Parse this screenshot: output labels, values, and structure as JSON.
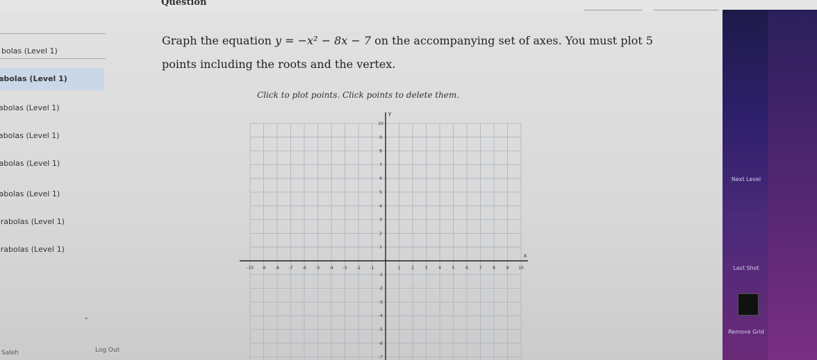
{
  "header": {
    "title": "Question"
  },
  "sidebar": {
    "items": [
      {
        "label": "bolas (Level 1)",
        "active": false
      },
      {
        "label": "abolas (Level 1)",
        "active": true
      },
      {
        "label": "abolas (Level 1)",
        "active": false
      },
      {
        "label": "abolas (Level 1)",
        "active": false
      },
      {
        "label": "rabolas (Level 1)",
        "active": false
      },
      {
        "label": "rabolas (Level 1)",
        "active": false
      },
      {
        "label": "arabolas (Level 1)",
        "active": false
      },
      {
        "label": "arabolas (Level 1)",
        "active": false
      }
    ],
    "bottom_left": "Saleh",
    "logout": "Log Out"
  },
  "question": {
    "line1_pre": "Graph the equation ",
    "equation": "y = −x² − 8x − 7",
    "line1_post": " on the accompanying set of axes. You must plot 5",
    "line2": "points including the roots and the vertex.",
    "instruction": "Click to plot points. Click points to delete them."
  },
  "graph": {
    "x_axis_label": "x",
    "y_axis_label": "y",
    "x_tick_labels": [
      "-10",
      "-9",
      "-8",
      "-7",
      "-6",
      "-5",
      "-4",
      "-3",
      "-2",
      "-1",
      "1",
      "2",
      "3",
      "4",
      "5",
      "6",
      "7",
      "8",
      "9",
      "10"
    ],
    "y_tick_labels": [
      "10",
      "9",
      "8",
      "7",
      "6",
      "5",
      "4",
      "3",
      "2",
      "1",
      "-1",
      "-2",
      "-3",
      "-4",
      "-5",
      "-6",
      "-7"
    ]
  },
  "right_panel": {
    "label_a": "Next Level",
    "label_b": "Last Shot",
    "label_c": "Remove Grid"
  }
}
